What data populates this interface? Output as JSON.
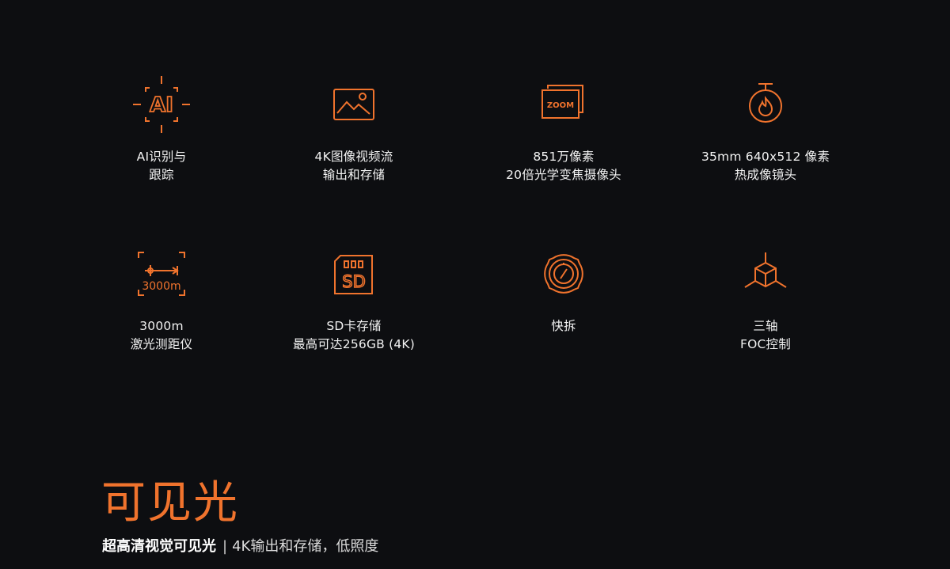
{
  "features": [
    {
      "icon": "ai-recognition-icon",
      "lines": [
        "AI识别与",
        "跟踪"
      ],
      "icon_text": "AI"
    },
    {
      "icon": "image-video-icon",
      "lines": [
        "4K图像视频流",
        "输出和存储"
      ]
    },
    {
      "icon": "zoom-camera-icon",
      "lines": [
        "851万像素",
        "20倍光学变焦摄像头"
      ],
      "icon_text": "ZOOM"
    },
    {
      "icon": "thermal-camera-icon",
      "lines": [
        "35mm 640x512 像素",
        "热成像镜头"
      ]
    },
    {
      "icon": "laser-rangefinder-icon",
      "lines": [
        "3000m",
        "激光测距仪"
      ],
      "icon_text": "3000m"
    },
    {
      "icon": "sd-card-icon",
      "lines": [
        "SD卡存储",
        "最高可达256GB (4K)"
      ],
      "icon_text": "SD"
    },
    {
      "icon": "quick-release-icon",
      "lines": [
        "快拆"
      ]
    },
    {
      "icon": "three-axis-gimbal-icon",
      "lines": [
        "三轴",
        "FOC控制"
      ]
    }
  ],
  "section": {
    "title": "可见光",
    "subtitle_strong": "超高清视觉可见光",
    "separator": "|",
    "subtitle_rest": "4K输出和存储，低照度"
  },
  "colors": {
    "accent": "#f0732d",
    "background": "#0d0e11",
    "text": "#f2f2f2"
  }
}
